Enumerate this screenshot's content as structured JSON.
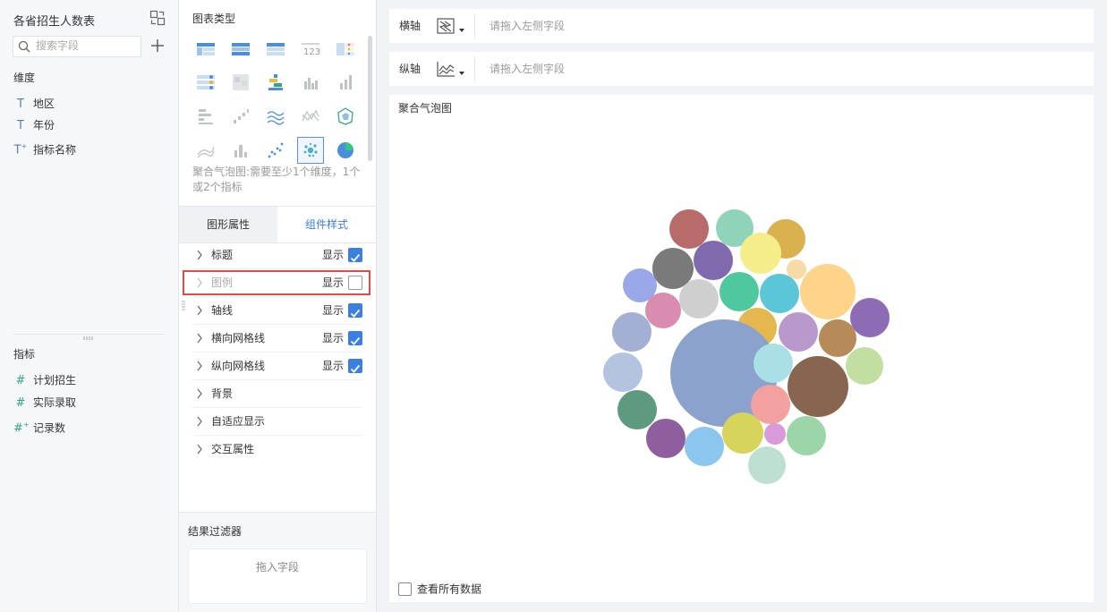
{
  "left_panel": {
    "dataset_title": "各省招生人数表",
    "search": {
      "placeholder": "搜索字段",
      "value": ""
    },
    "dimension_label": "维度",
    "dimensions": [
      {
        "icon": "text-field-icon",
        "label": "地区"
      },
      {
        "icon": "text-field-icon",
        "label": "年份"
      },
      {
        "icon": "text-field-calc-icon",
        "label": "指标名称"
      }
    ],
    "measure_label": "指标",
    "measures": [
      {
        "icon": "number-field-icon",
        "label": "计划招生"
      },
      {
        "icon": "number-field-icon",
        "label": "实际录取"
      },
      {
        "icon": "number-field-calc-icon",
        "label": "记录数"
      }
    ]
  },
  "middle_panel": {
    "chart_type_title": "图表类型",
    "chart_hint": "聚合气泡图:需要至少1个维度，1个或2个指标",
    "selected_chart": "aggregated-bubble",
    "tabs": [
      {
        "label": "图形属性",
        "active": false
      },
      {
        "label": "组件样式",
        "active": true
      }
    ],
    "properties": [
      {
        "label": "标题",
        "show_label": "显示",
        "checked": true,
        "dim": false
      },
      {
        "label": "图例",
        "show_label": "显示",
        "checked": false,
        "dim": true
      },
      {
        "label": "轴线",
        "show_label": "显示",
        "checked": true,
        "dim": false
      },
      {
        "label": "横向网格线",
        "show_label": "显示",
        "checked": true,
        "dim": false
      },
      {
        "label": "纵向网格线",
        "show_label": "显示",
        "checked": true,
        "dim": false
      },
      {
        "label": "背景",
        "show_label": "",
        "checked": null,
        "dim": false
      },
      {
        "label": "自适应显示",
        "show_label": "",
        "checked": null,
        "dim": false
      },
      {
        "label": "交互属性",
        "show_label": "",
        "checked": null,
        "dim": false
      }
    ],
    "filter_title": "结果过滤器",
    "filter_drop_text": "拖入字段"
  },
  "axes": {
    "x": {
      "label": "横轴",
      "placeholder": "请拖入左侧字段"
    },
    "y": {
      "label": "纵轴",
      "placeholder": "请拖入左侧字段"
    }
  },
  "canvas": {
    "title": "聚合气泡图",
    "view_all_label": "查看所有数据",
    "view_all_checked": false
  },
  "colors": {
    "accent": "#3b7fe0",
    "highlight": "#e04a4a",
    "bubbles": [
      "#b86b6b",
      "#8fd3b8",
      "#d9b24f",
      "#7f6aad",
      "#f5ec8a",
      "#7a7a7a",
      "#f6dba6",
      "#9aa8ea",
      "#4fc8a0",
      "#5bc6d8",
      "#fdd48a",
      "#d98cb0",
      "#cfcfcf",
      "#8e6bb5",
      "#a3b0d4",
      "#e4b84f",
      "#b998cc",
      "#b78a5a",
      "#8aa2cc",
      "#a9e0e6",
      "#b4c3e0",
      "#87654f",
      "#c2dea0",
      "#5e9a80",
      "#f2a0a0",
      "#8e5e9e",
      "#8cc6ef",
      "#d6d45a",
      "#d89ad8",
      "#9cd6a8",
      "#bde0d2",
      "#f7e45a"
    ]
  }
}
